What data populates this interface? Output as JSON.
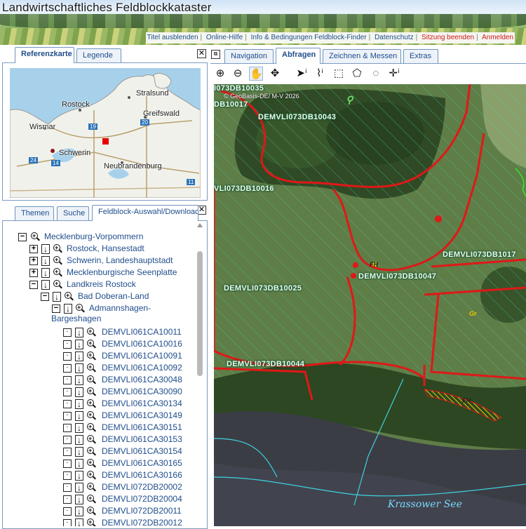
{
  "header": {
    "title": "Landwirtschaftliches Feldblockkataster",
    "links": [
      {
        "label": "Titel ausblenden",
        "color": "blue"
      },
      {
        "label": "Online-Hilfe",
        "color": "blue"
      },
      {
        "label": "Info & Bedingungen Feldblock-Finder",
        "color": "blue"
      },
      {
        "label": "Datenschutz",
        "color": "blue"
      },
      {
        "label": "Sitzung beenden",
        "color": "red"
      },
      {
        "label": "Anmelden",
        "color": "red"
      }
    ]
  },
  "left_top_tabs": [
    {
      "label": "Referenzkarte",
      "active": true
    },
    {
      "label": "Legende",
      "active": false
    }
  ],
  "close_glyph": "✕",
  "refmap": {
    "cities": [
      "Stralsund",
      "Rostock",
      "Greifswald",
      "Wismar",
      "Schwerin",
      "Neubrandenburg"
    ],
    "road_numbers": [
      "19",
      "20",
      "24",
      "14",
      "11"
    ]
  },
  "left_bottom_tabs": [
    {
      "label": "Themen",
      "active": false
    },
    {
      "label": "Suche",
      "active": false
    },
    {
      "label": "Feldblock-Auswahl/Download",
      "active": true
    }
  ],
  "tree": {
    "expander_minus": "−",
    "expander_plus": "+",
    "download_glyph": "↓",
    "nodes": [
      {
        "label": "Mecklenburg-Vorpommern",
        "expander": "minus",
        "download": false
      },
      {
        "label": "Rostock, Hansestadt",
        "expander": "plus",
        "download": true
      },
      {
        "label": "Schwerin, Landeshauptstadt",
        "expander": "plus",
        "download": true
      },
      {
        "label": "Mecklenburgische Seenplatte",
        "expander": "plus",
        "download": true
      },
      {
        "label": "Landkreis Rostock",
        "expander": "minus",
        "download": true
      },
      {
        "label": "Bad Doberan-Land",
        "expander": "minus",
        "download": true
      },
      {
        "label": "Admannshagen-",
        "label2": "Bargeshagen",
        "expander": "minus",
        "download": true
      }
    ],
    "leaves": [
      "DEMVLI061CA10011",
      "DEMVLI061CA10016",
      "DEMVLI061CA10091",
      "DEMVLI061CA10092",
      "DEMVLI061CA30048",
      "DEMVLI061CA30090",
      "DEMVLI061CA30134",
      "DEMVLI061CA30149",
      "DEMVLI061CA30151",
      "DEMVLI061CA30153",
      "DEMVLI061CA30154",
      "DEMVLI061CA30165",
      "DEMVLI061CA30166",
      "DEMVLI072DB20002",
      "DEMVLI072DB20004",
      "DEMVLI072DB20011",
      "DEMVLI072DB20012"
    ]
  },
  "main_tabs": [
    {
      "label": "Navigation",
      "active": false
    },
    {
      "label": "Abfragen",
      "active": true
    },
    {
      "label": "Zeichnen & Messen",
      "active": false
    },
    {
      "label": "Extras",
      "active": false
    }
  ],
  "toolbar_icons": [
    {
      "name": "zoom-in-icon",
      "glyph": "⊕",
      "active": false
    },
    {
      "name": "zoom-out-icon",
      "glyph": "⊖",
      "active": false
    },
    {
      "name": "pan-hand-icon",
      "glyph": "✋",
      "active": true
    },
    {
      "name": "move-cross-icon",
      "glyph": "✥",
      "active": false
    },
    {
      "name": "info-point-icon",
      "glyph": "➤ⁱ",
      "active": false
    },
    {
      "name": "info-line-icon",
      "glyph": "⌇ⁱ",
      "active": false
    },
    {
      "name": "info-rectangle-icon",
      "glyph": "⬚",
      "active": false
    },
    {
      "name": "info-polygon-icon",
      "glyph": "⬠",
      "active": false
    },
    {
      "name": "info-circle-icon",
      "glyph": "◌",
      "active": false
    },
    {
      "name": "info-coordinate-icon",
      "glyph": "✛ⁱ",
      "active": false
    }
  ],
  "map": {
    "copyright": "© GeoBasis-DE/ M-V 2026",
    "field_labels": [
      "I073DB10035",
      "DB10017",
      "DEMVLI073DB10043",
      "VLI073DB10016",
      "DEMVLI073DB10047",
      "DEMVLI073DB10025",
      "DEMVLI073DB10044",
      "DEMVLI073DB1017"
    ],
    "small_tags": [
      "FH",
      "Gr",
      "FH"
    ],
    "lake": "Krassower See"
  }
}
